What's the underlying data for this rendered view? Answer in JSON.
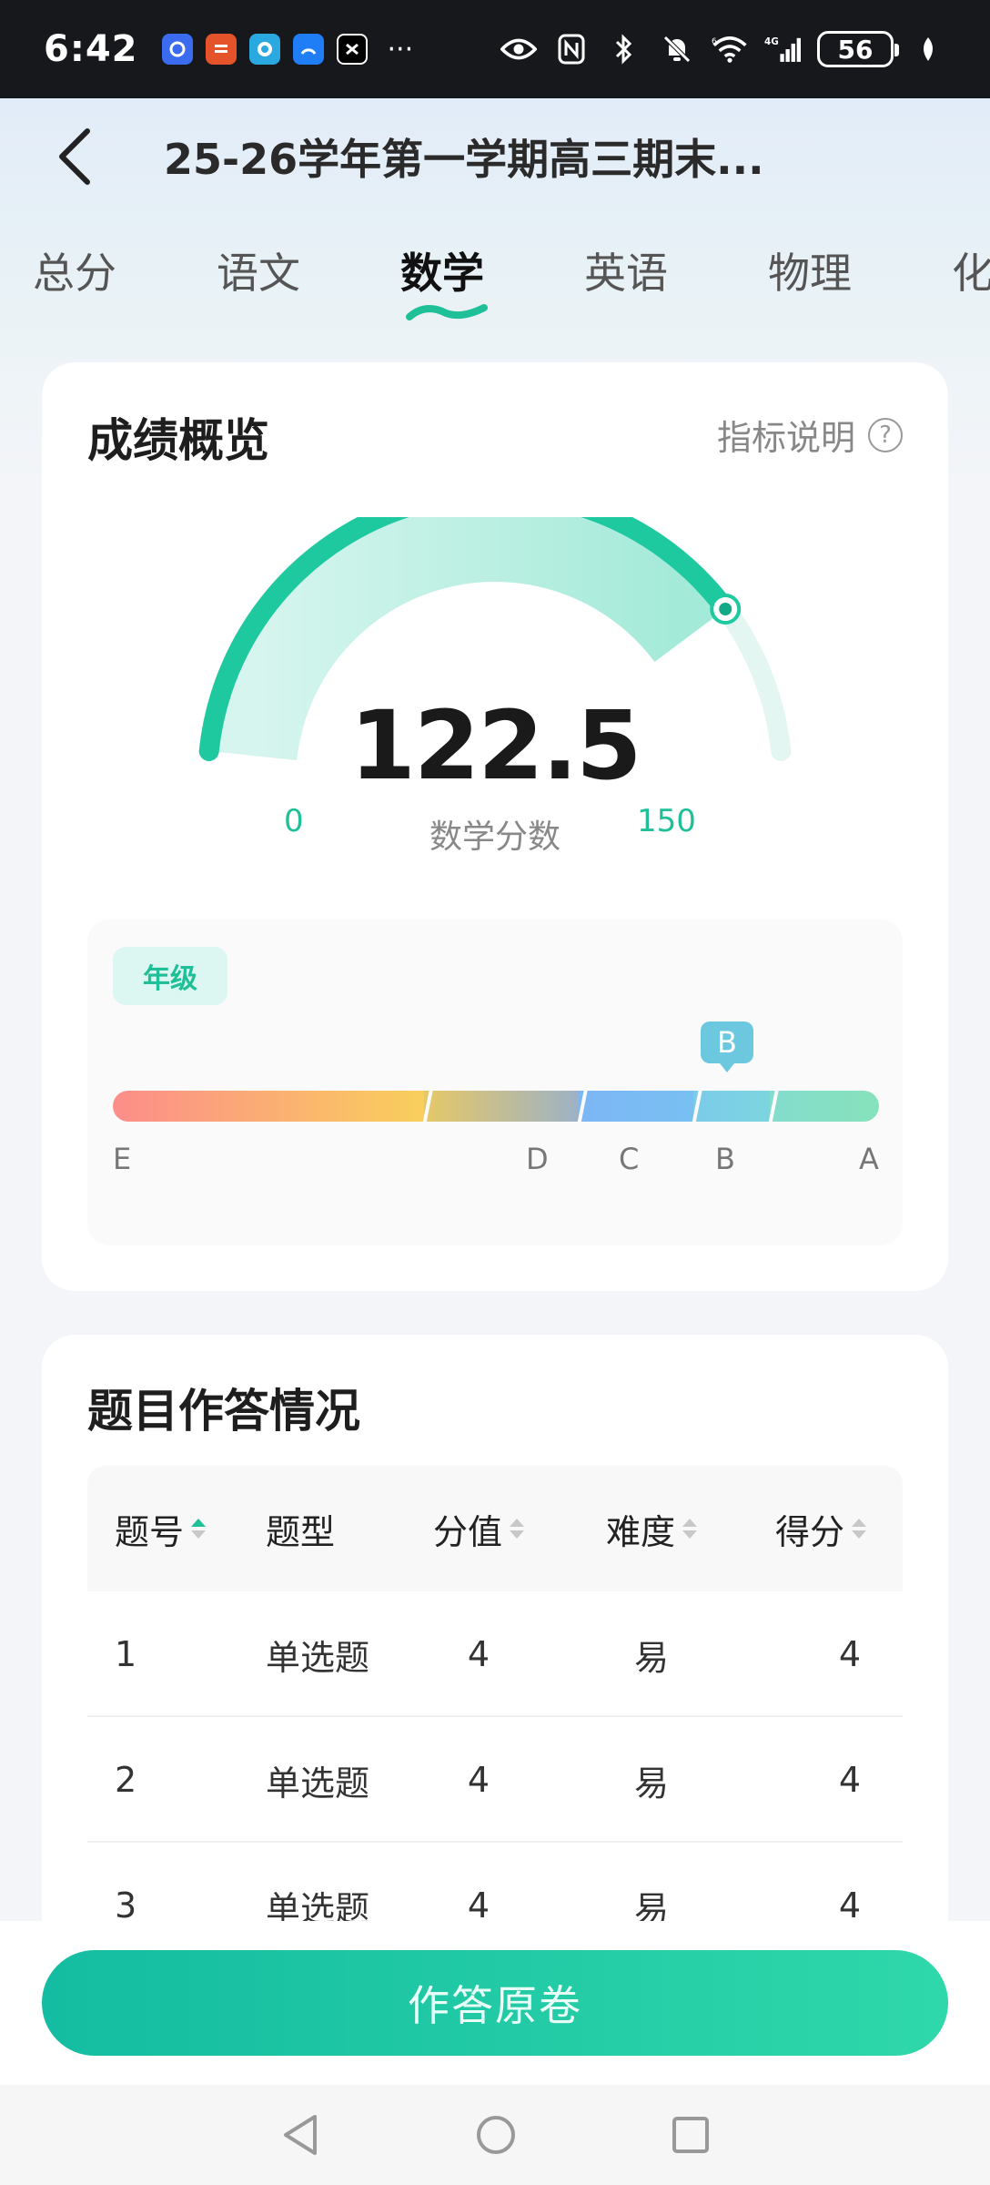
{
  "status_bar": {
    "time": "6:42",
    "dots": "···",
    "battery": "56",
    "network": "4G",
    "wifi_tag": "6"
  },
  "nav": {
    "title": "25-26学年第一学期高三期末..."
  },
  "tabs": [
    {
      "label": "总分",
      "active": false
    },
    {
      "label": "语文",
      "active": false
    },
    {
      "label": "数学",
      "active": true
    },
    {
      "label": "英语",
      "active": false
    },
    {
      "label": "物理",
      "active": false
    },
    {
      "label": "化",
      "active": false
    }
  ],
  "overview": {
    "title": "成绩概览",
    "metric_link": "指标说明",
    "score": "122.5",
    "score_label": "数学分数",
    "min": "0",
    "max": "150",
    "score_fraction": 0.817,
    "grade_tag": "年级",
    "grade_marker": "B",
    "grade_letters": [
      "E",
      "D",
      "C",
      "B",
      "A"
    ]
  },
  "answers": {
    "title": "题目作答情况",
    "columns": [
      "题号",
      "题型",
      "分值",
      "难度",
      "得分"
    ],
    "rows": [
      [
        "1",
        "单选题",
        "4",
        "易",
        "4"
      ],
      [
        "2",
        "单选题",
        "4",
        "易",
        "4"
      ],
      [
        "3",
        "单选题",
        "4",
        "易",
        "4"
      ]
    ]
  },
  "bottom": {
    "button_label": "作答原卷"
  },
  "colors": {
    "accent": "#1fbf98",
    "grade_marker": "#6cc8de"
  }
}
